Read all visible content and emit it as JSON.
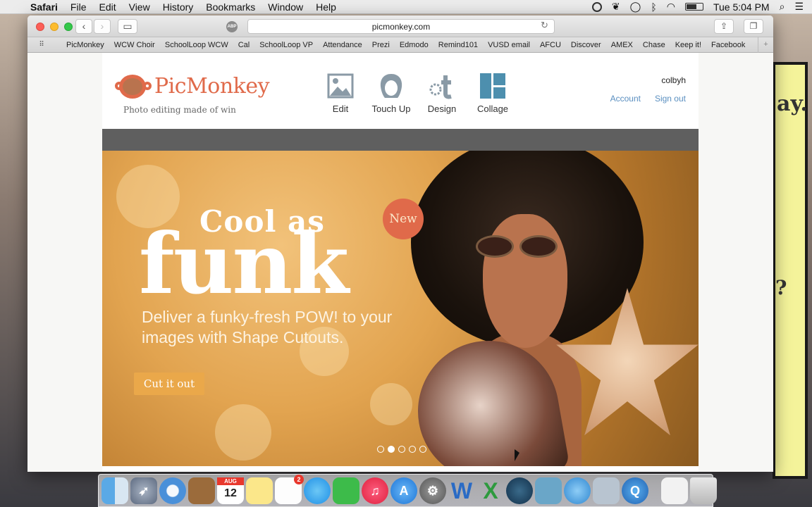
{
  "menubar": {
    "app": "Safari",
    "items": [
      "File",
      "Edit",
      "View",
      "History",
      "Bookmarks",
      "Window",
      "Help"
    ],
    "clock": "Tue 5:04 PM"
  },
  "toolbar": {
    "url": "picmonkey.com",
    "abp_label": "ABP"
  },
  "favorites": [
    "PicMonkey",
    "WCW Choir",
    "SchoolLoop WCW",
    "Cal",
    "SchoolLoop VP",
    "Attendance",
    "Prezi",
    "Edmodo",
    "Remind101",
    "VUSD email",
    "AFCU",
    "Discover",
    "AMEX",
    "Chase",
    "Keep it!",
    "Facebook"
  ],
  "site": {
    "brand": "PicMonkey",
    "tagline": "Photo editing made of win",
    "tools": [
      {
        "label": "Edit",
        "icon": "edit-photo-icon"
      },
      {
        "label": "Touch Up",
        "icon": "touch-up-face-icon"
      },
      {
        "label": "Design",
        "icon": "design-icon"
      },
      {
        "label": "Collage",
        "icon": "collage-icon"
      }
    ],
    "username": "colbyh",
    "account_link": "Account",
    "signout_link": "Sign out"
  },
  "hero": {
    "badge": "New",
    "headline_line1": "Cool as",
    "headline_line2": "funk",
    "subtext": "Deliver a funky-fresh POW! to your images with Shape Cutouts.",
    "cta": "Cut it out",
    "dots_total": 5,
    "dots_active": 2
  },
  "dock": {
    "calendar_month": "AUG",
    "calendar_day": "12",
    "reminders_badge": "2"
  },
  "colors": {
    "brand": "#e06a4a",
    "link": "#5a8fc0",
    "cta": "#eaa84a"
  }
}
